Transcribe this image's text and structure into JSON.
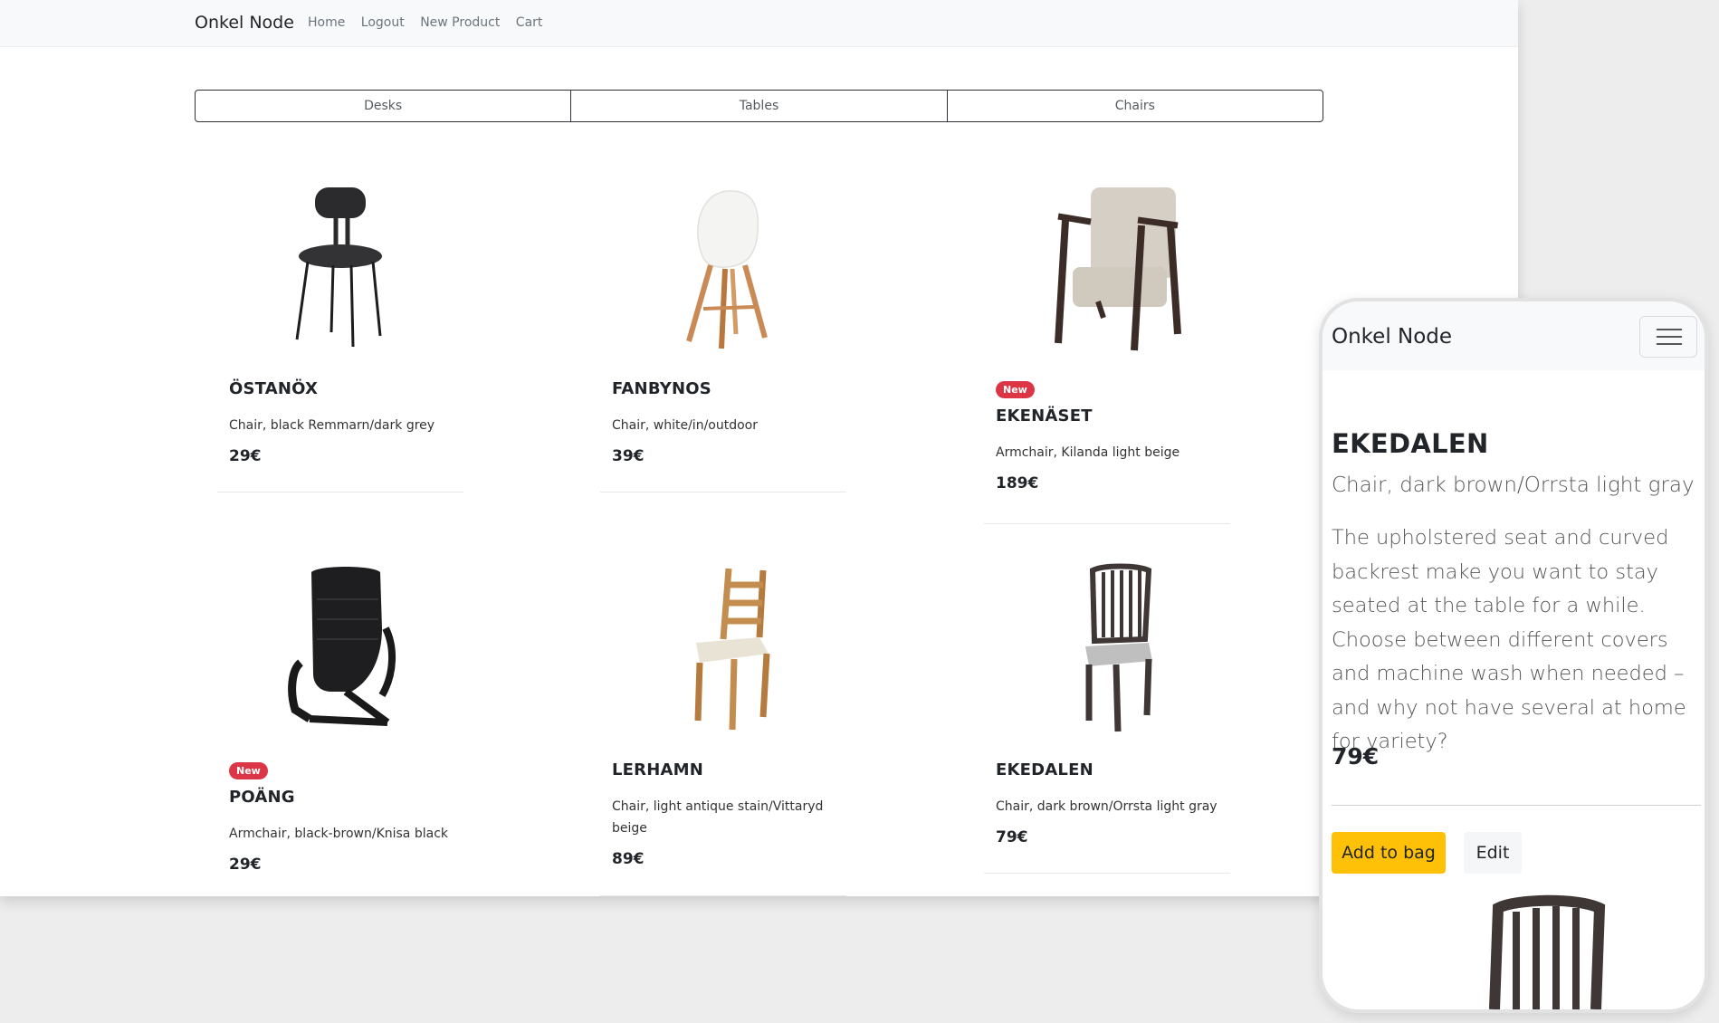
{
  "desktop": {
    "brand": "Onkel Node",
    "nav": [
      "Home",
      "Logout",
      "New Product",
      "Cart"
    ],
    "categories": [
      "Desks",
      "Tables",
      "Chairs"
    ],
    "products": [
      {
        "name": "ÖSTANÖX",
        "desc": "Chair, black Remmarn/dark grey",
        "price": "29€",
        "badge": "",
        "image": "black-metal-chair-image"
      },
      {
        "name": "FANBYNOS",
        "desc": "Chair, white/in/outdoor",
        "price": "39€",
        "badge": "",
        "image": "white-shell-chair-image"
      },
      {
        "name": "EKENÄSET",
        "desc": "Armchair, Kilanda light beige",
        "price": "189€",
        "badge": "New",
        "image": "beige-armchair-image"
      },
      {
        "name": "POÄNG",
        "desc": "Armchair, black-brown/Knisa black",
        "price": "29€",
        "badge": "New",
        "image": "black-cantilever-armchair-image"
      },
      {
        "name": "LERHAMN",
        "desc": "Chair, light antique stain/Vittaryd beige",
        "price": "89€",
        "badge": "",
        "image": "wooden-ladder-chair-image"
      },
      {
        "name": "EKEDALEN",
        "desc": "Chair, dark brown/Orrsta light gray",
        "price": "79€",
        "badge": "",
        "image": "dark-brown-chair-image"
      }
    ]
  },
  "mobile": {
    "brand": "Onkel Node",
    "title": "EKEDALEN",
    "subtitle": "Chair, dark brown/Orrsta light gray",
    "description": "The upholstered seat and curved backrest make you want to stay seated at the table for a while. Choose between different covers and machine wash when needed – and why not have several at home for variety?",
    "price": "79€",
    "add_label": "Add to bag",
    "edit_label": "Edit"
  },
  "colors": {
    "badge": "#dc3545",
    "add_button": "#ffc107",
    "navbar": "#f8f9fa",
    "backdrop": "#ededed"
  }
}
